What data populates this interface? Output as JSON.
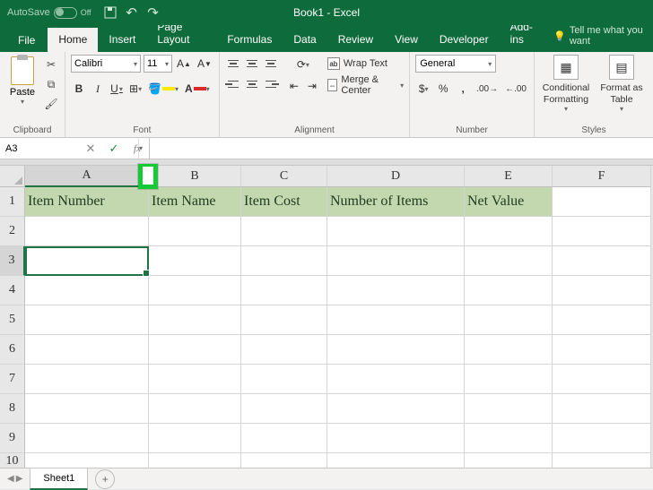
{
  "title_bar": {
    "autosave_label": "AutoSave",
    "autosave_state": "Off",
    "document_title": "Book1 - Excel"
  },
  "tabs": {
    "file": "File",
    "items": [
      "Home",
      "Insert",
      "Page Layout",
      "Formulas",
      "Data",
      "Review",
      "View",
      "Developer",
      "Add-ins"
    ],
    "active_index": 0,
    "tellme": "Tell me what you want"
  },
  "ribbon": {
    "clipboard": {
      "paste": "Paste",
      "label": "Clipboard"
    },
    "font": {
      "name": "Calibri",
      "size": "11",
      "label": "Font"
    },
    "alignment": {
      "wrap": "Wrap Text",
      "merge": "Merge & Center",
      "label": "Alignment"
    },
    "number": {
      "format": "General",
      "label": "Number"
    },
    "styles": {
      "conditional": "Conditional Formatting",
      "formatas": "Format as Table",
      "label": "Styles"
    }
  },
  "formula_bar": {
    "name_box": "A3",
    "formula": ""
  },
  "grid": {
    "columns": [
      "A",
      "B",
      "C",
      "D",
      "E",
      "F"
    ],
    "row_numbers": [
      "1",
      "2",
      "3",
      "4",
      "5",
      "6",
      "7",
      "8",
      "9",
      "10"
    ],
    "headers": {
      "A": "Item Number",
      "B": "Item Name",
      "C": "Item Cost",
      "D": "Number of Items",
      "E": "Net Value"
    },
    "active_cell": "A3"
  },
  "sheet_tabs": {
    "active": "Sheet1"
  }
}
